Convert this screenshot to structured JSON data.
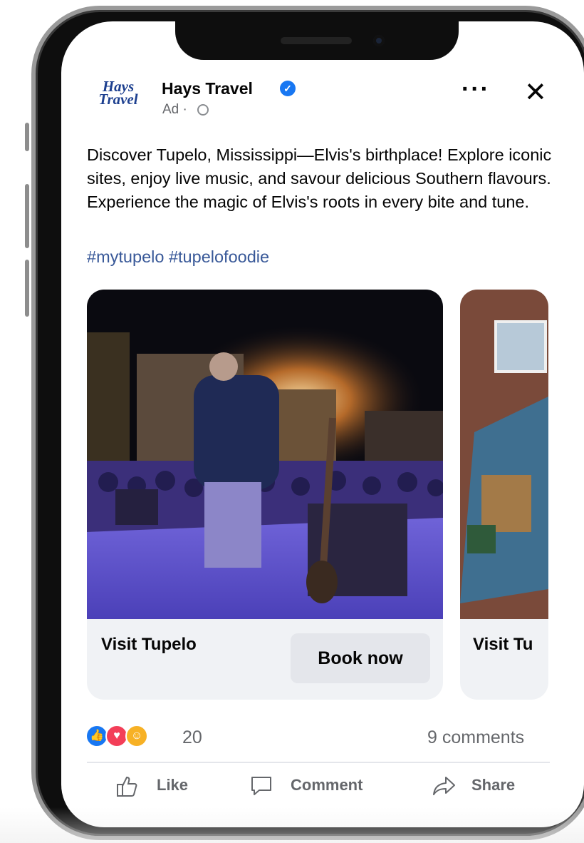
{
  "post": {
    "logo_line1": "Hays",
    "logo_line2": "Travel",
    "page_name": "Hays Travel",
    "sponsored": "Ad ·",
    "body": "Discover Tupelo, Mississippi—Elvis's birthplace! Explore iconic sites, enjoy live music, and savour delicious Southern flavours. Experience the magic of Elvis's roots in every bite and tune.",
    "hashtags": "#mytupelo #tupelofoodie"
  },
  "carousel": [
    {
      "title": "Visit Tupelo",
      "cta": "Book now"
    },
    {
      "title": "Visit Tu"
    }
  ],
  "engagement": {
    "reaction_count": "20",
    "comments": "9 comments"
  },
  "actions": {
    "like": "Like",
    "comment": "Comment",
    "share": "Share"
  },
  "icons": [
    "verified-icon",
    "globe-icon",
    "more-icon",
    "close-icon",
    "like-reaction-icon",
    "love-reaction-icon",
    "care-reaction-icon",
    "thumbs-up-icon",
    "comment-icon",
    "share-icon"
  ],
  "colors": {
    "brand_blue": "#1877f2",
    "hashtag": "#385898",
    "muted": "#65676b"
  }
}
